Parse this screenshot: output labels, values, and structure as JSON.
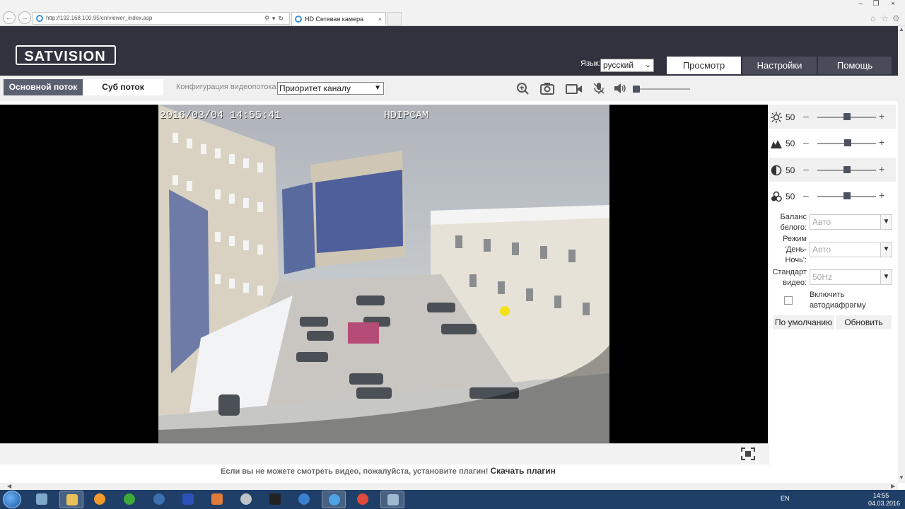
{
  "browser": {
    "url": "http://192.168.100.95/cn/viewer_index.asp",
    "tab_title": "HD Сетевая камера"
  },
  "header": {
    "logo_text": "SATVISION",
    "lang_label": "Язык:",
    "lang_value": "русский",
    "nav": [
      "Просмотр",
      "Настройки",
      "Помощь"
    ],
    "active_nav": "Просмотр"
  },
  "toolbar": {
    "stream_main": "Основной поток",
    "stream_sub": "Суб поток",
    "config_label": "Конфигурация видеопотока:",
    "config_value": "Приоритет каналу",
    "icons": [
      "zoom-in-icon",
      "snapshot-icon",
      "record-icon",
      "microphone-icon",
      "speaker-icon"
    ]
  },
  "video": {
    "osd_timestamp": "2016/03/04 14:55:41",
    "osd_name": "HDIPCAM"
  },
  "plugin": {
    "message": "Если вы не можете смотреть видео, пожалуйста, установите плагин!",
    "link": "Скачать плагин"
  },
  "image_settings": {
    "sliders": [
      {
        "name": "brightness",
        "icon": "sun-icon",
        "value": "50"
      },
      {
        "name": "sharpness",
        "icon": "sharpness-icon",
        "value": "50"
      },
      {
        "name": "contrast",
        "icon": "contrast-icon",
        "value": "50"
      },
      {
        "name": "saturation",
        "icon": "saturation-icon",
        "value": "50"
      }
    ],
    "white_balance_label": "Баланс белого:",
    "white_balance_value": "Авто",
    "day_night_label": "Режим 'День-Ночь':",
    "day_night_value": "Авто",
    "video_standard_label": "Стандарт видео:",
    "video_standard_value": "50Hz",
    "auto_iris_label": "Включить автодиафрагму",
    "default_button": "По умолчанию",
    "refresh_button": "Обновить"
  },
  "taskbar": {
    "lang": "EN",
    "time": "14:55",
    "date": "04.03.2016"
  },
  "colors": {
    "header_bg": "#31323e",
    "active_stream": "#5b6070",
    "taskbar": "#1f3f68"
  }
}
